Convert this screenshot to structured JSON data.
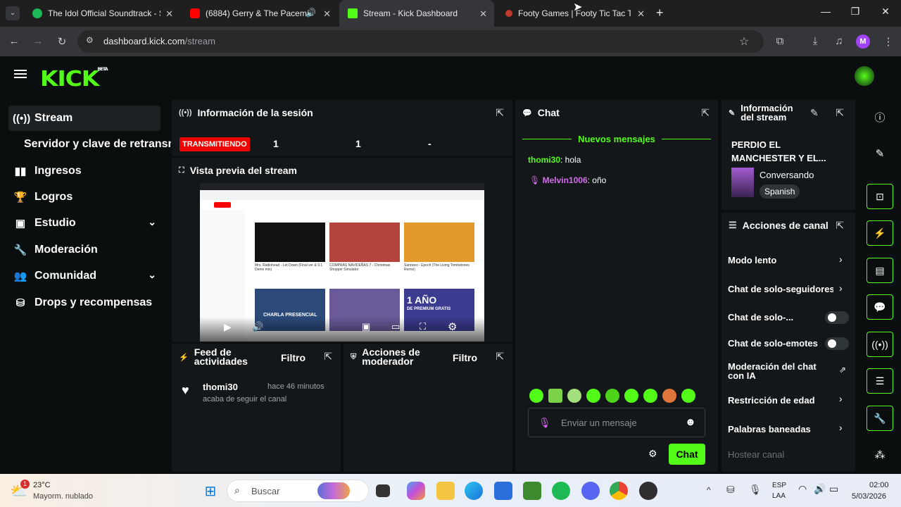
{
  "browser": {
    "tabs": [
      {
        "title": "The Idol Official Soundtrack - S",
        "favicon_color": "#1db954"
      },
      {
        "title": "(6884) Gerry & The Pacema",
        "favicon_color": "#ff0000"
      },
      {
        "title": "Stream - Kick Dashboard",
        "favicon_color": "#53fc18"
      },
      {
        "title": "Footy Games | Footy Tic Tac Toe",
        "favicon_color": "#c0392b"
      }
    ],
    "url_host": "dashboard.kick.com",
    "url_path": "/stream",
    "profile_initial": "M"
  },
  "kick": {
    "logo": "KICK",
    "logo_badge": "BETA"
  },
  "sidebar": {
    "items": [
      {
        "label": "Stream",
        "icon": "broadcast-icon"
      },
      {
        "label": "Servidor y clave de retransm",
        "icon": ""
      },
      {
        "label": "Ingresos",
        "icon": "chart-icon"
      },
      {
        "label": "Logros",
        "icon": "trophy-icon"
      },
      {
        "label": "Estudio",
        "icon": "studio-icon"
      },
      {
        "label": "Moderación",
        "icon": "wrench-icon"
      },
      {
        "label": "Comunidad",
        "icon": "users-icon"
      },
      {
        "label": "Drops y recompensas",
        "icon": "drops-icon"
      }
    ]
  },
  "session": {
    "title": "Información de la sesión",
    "status": "TRANSMITIENDO",
    "stat1": "1",
    "stat2": "1",
    "stat3": "-"
  },
  "preview": {
    "title": "Vista previa del stream",
    "yt_video1": "Mrs. Radiohead - Let Down (Final ver & 9.1 Demo mix)",
    "yt_video2": "COMPRAS NAVIDEÑAS 7 - Christmas Shopper Simulator",
    "yt_video3": "Sanrizeo - Epoch (The Living Tombstones Remix)",
    "yt_card1": "CHARLA PRESENCIAL",
    "yt_card3": "1 AÑO",
    "yt_card3_sub": "DE PREMIUM GRATIS"
  },
  "activity": {
    "title": "Feed de actividades",
    "filter": "Filtro",
    "user": "thomi30",
    "time": "hace 46 minutos",
    "text": "acaba de seguir el canal"
  },
  "modactions": {
    "title": "Acciones de moderador",
    "filter": "Filtro"
  },
  "chat": {
    "title": "Chat",
    "new_messages": "Nuevos mensajes",
    "messages": [
      {
        "user": "thomi30",
        "text": ": hola",
        "color": "#53fc18"
      },
      {
        "user": "Melvin1006",
        "text": ": oño",
        "color": "#d16fe8"
      }
    ],
    "input_placeholder": "Enviar un mensaje",
    "send_label": "Chat"
  },
  "stream_info": {
    "title": "Información del stream",
    "stream_title": "PERDIO EL MANCHESTER Y EL...",
    "category": "Conversando",
    "language": "Spanish"
  },
  "channel_actions": {
    "title": "Acciones de canal",
    "items": [
      "Modo lento",
      "Chat de solo-seguidores",
      "Chat de solo-...",
      "Chat de solo-emotes",
      "Moderación del chat con IA",
      "Restricción de edad",
      "Palabras baneadas",
      "Hostear canal"
    ]
  },
  "taskbar": {
    "weather_temp": "23°C",
    "weather_desc": "Mayorm. nublado",
    "weather_badge": "1",
    "search": "Buscar",
    "lang1": "ESP",
    "lang2": "LAA",
    "time": "02:00",
    "date": "5/03/2026"
  },
  "colors": {
    "kick_green": "#53fc18",
    "live_red": "#eb0400",
    "panel_bg": "#141719",
    "page_bg": "#0b0e0f"
  }
}
